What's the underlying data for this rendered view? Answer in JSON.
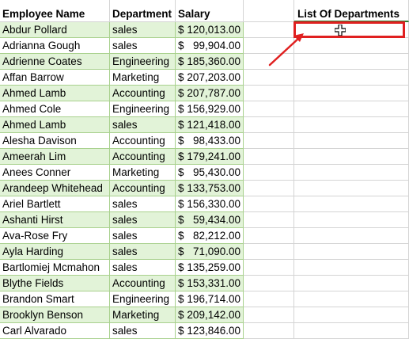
{
  "headers": {
    "employee_name": "Employee Name",
    "department": "Department",
    "salary": "Salary",
    "list_of_departments": "List Of Departments"
  },
  "rows": [
    {
      "name": "Abdur Pollard",
      "dept": "sales",
      "cur": "$",
      "amt": "120,013.00"
    },
    {
      "name": "Adrianna Gough",
      "dept": "sales",
      "cur": "$",
      "amt": "99,904.00"
    },
    {
      "name": "Adrienne Coates",
      "dept": "Engineering",
      "cur": "$",
      "amt": "185,360.00"
    },
    {
      "name": "Affan Barrow",
      "dept": "Marketing",
      "cur": "$",
      "amt": "207,203.00"
    },
    {
      "name": "Ahmed Lamb",
      "dept": "Accounting",
      "cur": "$",
      "amt": "207,787.00"
    },
    {
      "name": "Ahmed Cole",
      "dept": "Engineering",
      "cur": "$",
      "amt": "156,929.00"
    },
    {
      "name": "Ahmed Lamb",
      "dept": "sales",
      "cur": "$",
      "amt": "121,418.00"
    },
    {
      "name": "Alesha Davison",
      "dept": "Accounting",
      "cur": "$",
      "amt": "98,433.00"
    },
    {
      "name": "Ameerah Lim",
      "dept": "Accounting",
      "cur": "$",
      "amt": "179,241.00"
    },
    {
      "name": "Anees Conner",
      "dept": "Marketing",
      "cur": "$",
      "amt": "95,430.00"
    },
    {
      "name": "Arandeep Whitehead",
      "dept": "Accounting",
      "cur": "$",
      "amt": "133,753.00"
    },
    {
      "name": "Ariel Bartlett",
      "dept": "sales",
      "cur": "$",
      "amt": "156,330.00"
    },
    {
      "name": "Ashanti Hirst",
      "dept": "sales",
      "cur": "$",
      "amt": "59,434.00"
    },
    {
      "name": "Ava-Rose Fry",
      "dept": "sales",
      "cur": "$",
      "amt": "82,212.00"
    },
    {
      "name": "Ayla Harding",
      "dept": "sales",
      "cur": "$",
      "amt": "71,090.00"
    },
    {
      "name": "Bartlomiej Mcmahon",
      "dept": "sales",
      "cur": "$",
      "amt": "135,259.00"
    },
    {
      "name": "Blythe Fields",
      "dept": "Accounting",
      "cur": "$",
      "amt": "153,331.00"
    },
    {
      "name": "Brandon Smart",
      "dept": "Engineering",
      "cur": "$",
      "amt": "196,714.00"
    },
    {
      "name": "Brooklyn Benson",
      "dept": "Marketing",
      "cur": "$",
      "amt": "209,142.00"
    },
    {
      "name": "Carl Alvarado",
      "dept": "sales",
      "cur": "$",
      "amt": "123,846.00"
    }
  ],
  "colors": {
    "band": "#e2f3d8",
    "selection": "#e02020"
  },
  "icons": {
    "cursor": "cell-select-cross-icon",
    "arrow": "annotation-arrow-icon"
  }
}
